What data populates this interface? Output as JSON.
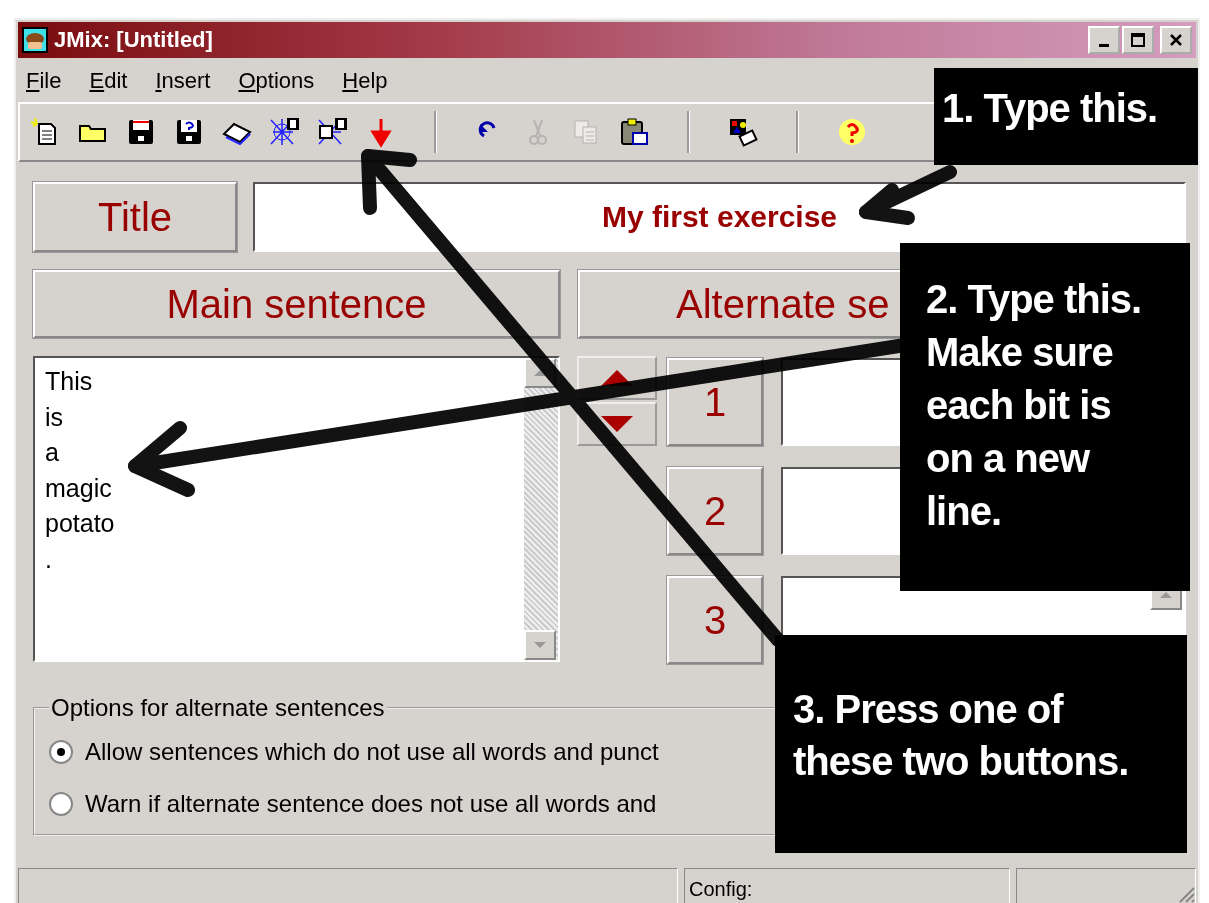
{
  "window": {
    "title": "JMix: [Untitled]"
  },
  "menu": [
    "File",
    "Edit",
    "Insert",
    "Options",
    "Help"
  ],
  "toolbar": [
    {
      "buttons": [
        {
          "disabled": false
        },
        {
          "disabled": false
        },
        {
          "disabled": false
        },
        {
          "disabled": false
        },
        {
          "disabled": false
        },
        {
          "disabled": false
        },
        {
          "disabled": false
        },
        {
          "disabled": false
        }
      ]
    },
    {
      "buttons": [
        {
          "disabled": false
        },
        {
          "disabled": true
        },
        {
          "disabled": true
        },
        {
          "disabled": false
        }
      ]
    },
    {
      "buttons": [
        {
          "disabled": false
        }
      ]
    },
    {
      "buttons": [
        {
          "disabled": false
        }
      ]
    }
  ],
  "title_label": "Title",
  "title_value": "My first exercise",
  "main_header": "Main sentence",
  "alternate_header": "Alternate se",
  "main_sentence_lines": [
    "This",
    "is",
    "a",
    "magic",
    "potato",
    "."
  ],
  "alternates": [
    {
      "number": "1"
    },
    {
      "number": "2"
    },
    {
      "number": "3"
    }
  ],
  "options": {
    "legend": "Options for alternate sentences",
    "choices": [
      {
        "label": "Allow sentences which do not use all words and punct",
        "selected": true
      },
      {
        "label": "Warn if alternate sentence does not use all words and",
        "selected": false
      }
    ]
  },
  "status_bar": {
    "config_label": "Config:"
  },
  "callouts": [
    "1. Type this.",
    "2. Type this.\nMake sure\neach bit is\non a new\nline.",
    "3. Press one of\nthese two buttons."
  ]
}
